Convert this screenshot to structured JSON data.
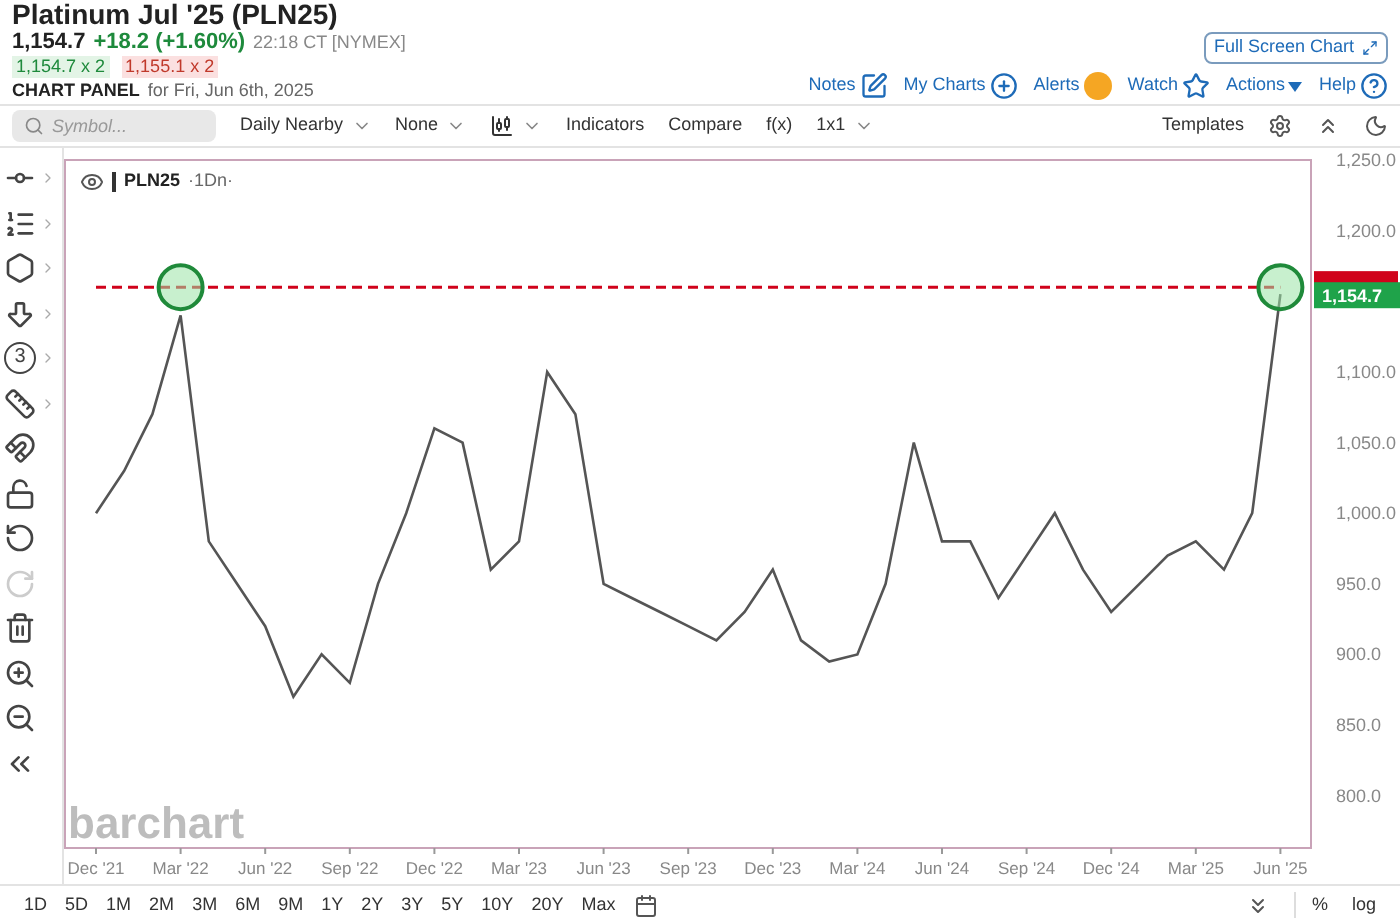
{
  "header": {
    "title": "Platinum Jul '25 (PLN25)",
    "last": "1,154.7",
    "change": "+18.2 (+1.60%)",
    "time": "22:18 CT [NYMEX]",
    "bid": "1,154.7 x 2",
    "ask": "1,155.1 x 2",
    "panel_label": "CHART PANEL",
    "panel_date": "for Fri, Jun 6th, 2025"
  },
  "full_screen_button": "Full Screen Chart",
  "nav_links": [
    {
      "label": "Notes",
      "kind": "notes"
    },
    {
      "label": "My Charts",
      "kind": "add"
    },
    {
      "label": "Alerts",
      "kind": "alert"
    },
    {
      "label": "Watch",
      "kind": "star"
    },
    {
      "label": "Actions",
      "kind": "menu"
    },
    {
      "label": "Help",
      "kind": "help"
    }
  ],
  "toolbar": {
    "search_placeholder": "Symbol...",
    "items": [
      {
        "label": "Daily Nearby",
        "kind": "dropdown"
      },
      {
        "label": "None",
        "kind": "dropdown"
      },
      {
        "kind": "bartype"
      },
      {
        "label": "Indicators",
        "kind": "plain"
      },
      {
        "label": "Compare",
        "kind": "plain"
      },
      {
        "label": "f(x)",
        "kind": "plain"
      },
      {
        "label": "1x1",
        "kind": "dropdown"
      }
    ],
    "templates": "Templates"
  },
  "tools": [
    {
      "kind": "line",
      "submenu": true,
      "disabled": false
    },
    {
      "kind": "fib",
      "submenu": true,
      "disabled": false
    },
    {
      "kind": "shape",
      "submenu": true,
      "disabled": false
    },
    {
      "kind": "arrow",
      "submenu": true,
      "disabled": false
    },
    {
      "kind": "counter",
      "label": "3",
      "submenu": true,
      "disabled": false
    },
    {
      "kind": "measure",
      "submenu": true,
      "disabled": false
    },
    {
      "kind": "magnet",
      "submenu": false,
      "disabled": false
    },
    {
      "kind": "lock",
      "submenu": false,
      "disabled": false
    },
    {
      "kind": "undo",
      "submenu": false,
      "disabled": false
    },
    {
      "kind": "redo",
      "submenu": false,
      "disabled": true
    },
    {
      "kind": "trash",
      "submenu": false,
      "disabled": false
    },
    {
      "kind": "zoomin",
      "submenu": false,
      "disabled": false
    },
    {
      "kind": "zoomout",
      "submenu": false,
      "disabled": false
    },
    {
      "kind": "collapse",
      "submenu": false,
      "disabled": false
    }
  ],
  "legend": {
    "symbol": "PLN25",
    "period": "·1Dn·"
  },
  "watermark_logo": "barchart",
  "chart": {
    "price_tag": "1,154.7",
    "chart_data": {
      "type": "line",
      "categories": [
        "Dec '21",
        null,
        null,
        "Mar '22",
        null,
        null,
        "Jun '22",
        null,
        null,
        "Sep '22",
        null,
        null,
        "Dec '22",
        null,
        null,
        "Mar '23",
        null,
        null,
        "Jun '23",
        null,
        null,
        "Sep '23",
        null,
        null,
        "Dec '23",
        null,
        null,
        "Mar '24",
        null,
        null,
        "Jun '24",
        null,
        null,
        "Sep '24",
        null,
        null,
        "Dec '24",
        null,
        null,
        "Mar '25",
        null,
        null,
        "Jun '25"
      ],
      "series": [
        {
          "color": "#555555",
          "line_style": "solid",
          "values": [
            1000,
            1030,
            1070,
            1140,
            980,
            950,
            920,
            870,
            900,
            880,
            950,
            1000,
            1060,
            1050,
            960,
            980,
            1100,
            1070,
            950,
            940,
            930,
            920,
            910,
            930,
            960,
            910,
            895,
            900,
            950,
            1050,
            980,
            980,
            940,
            970,
            1000,
            960,
            930,
            950,
            970,
            980,
            960,
            1000,
            1155
          ]
        },
        {
          "color": "#d0021b",
          "line_style": "dashed",
          "values": [
            1160,
            1160,
            1160,
            1160,
            1160,
            1160,
            1160,
            1160,
            1160,
            1160,
            1160,
            1160,
            1160,
            1160,
            1160,
            1160,
            1160,
            1160,
            1160,
            1160,
            1160,
            1160,
            1160,
            1160,
            1160,
            1160,
            1160,
            1160,
            1160,
            1160,
            1160,
            1160,
            1160,
            1160,
            1160,
            1160,
            1160,
            1160,
            1160,
            1160,
            1160,
            1160,
            1160
          ]
        }
      ],
      "ylim": [
        763,
        1250
      ],
      "yticks": [
        {
          "value": 800,
          "label": "800.0"
        },
        {
          "value": 850,
          "label": "850.0"
        },
        {
          "value": 900,
          "label": "900.0"
        },
        {
          "value": 950,
          "label": "950.0"
        },
        {
          "value": 1000,
          "label": "1,000.0"
        },
        {
          "value": 1050,
          "label": "1,050.0"
        },
        {
          "value": 1100,
          "label": "1,100.0"
        },
        {
          "value": 1200,
          "label": "1,200.0"
        },
        {
          "value": 1250,
          "label": "1,250.0"
        }
      ]
    }
  },
  "ranges": [
    {
      "label": "1D",
      "selected": false
    },
    {
      "label": "5D",
      "selected": false
    },
    {
      "label": "1M",
      "selected": false
    },
    {
      "label": "2M",
      "selected": false
    },
    {
      "label": "3M",
      "selected": false
    },
    {
      "label": "6M",
      "selected": false
    },
    {
      "label": "9M",
      "selected": false
    },
    {
      "label": "1Y",
      "selected": false
    },
    {
      "label": "2Y",
      "selected": false
    },
    {
      "label": "3Y",
      "selected": false
    },
    {
      "label": "5Y",
      "selected": false
    },
    {
      "label": "10Y",
      "selected": false
    },
    {
      "label": "20Y",
      "selected": false
    },
    {
      "label": "Max",
      "selected": false
    }
  ],
  "scale_options": [
    {
      "label": "%",
      "selected": false
    },
    {
      "label": "log",
      "selected": false
    }
  ]
}
